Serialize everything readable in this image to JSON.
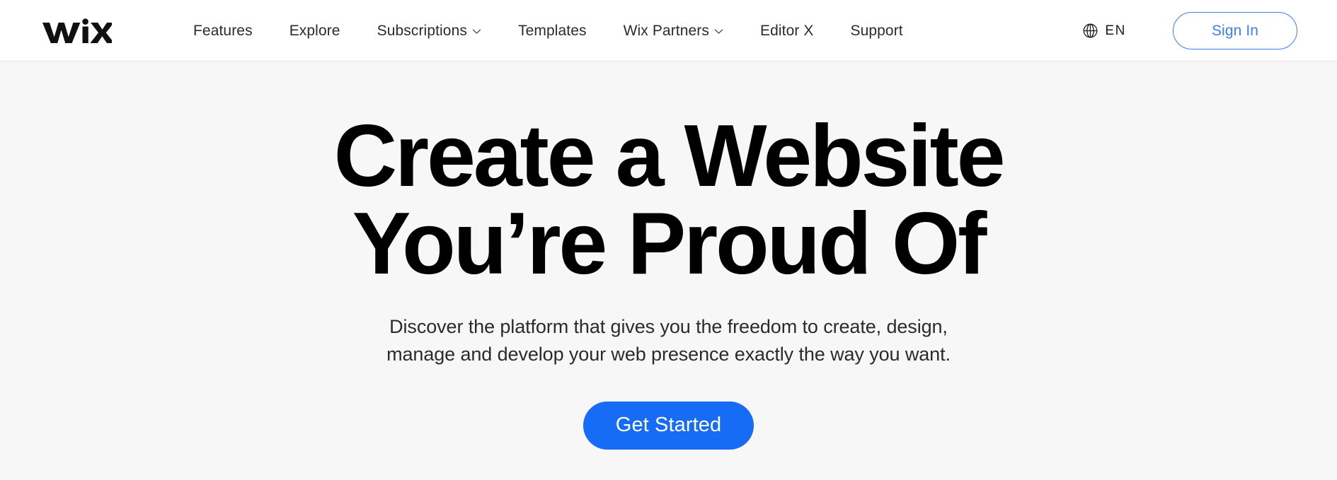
{
  "colors": {
    "accent_blue": "#166cf5",
    "link_blue": "#3d7cf5",
    "nav_background": "#ffffff",
    "hero_background": "#f7f7f7",
    "text_dark": "#2b2b2b",
    "heading_black": "#000000",
    "nav_border": "#e8e8e8"
  },
  "navbar": {
    "logo": {
      "name": "wix-logo",
      "text": "WiX"
    },
    "links": [
      {
        "label": "Features",
        "has_dropdown": false,
        "icon": null
      },
      {
        "label": "Explore",
        "has_dropdown": false,
        "icon": null
      },
      {
        "label": "Subscriptions",
        "has_dropdown": true,
        "icon": "chevron-down-icon"
      },
      {
        "label": "Templates",
        "has_dropdown": false,
        "icon": null
      },
      {
        "label": "Wix Partners",
        "has_dropdown": true,
        "icon": "chevron-down-icon"
      },
      {
        "label": "Editor X",
        "has_dropdown": false,
        "icon": null
      },
      {
        "label": "Support",
        "has_dropdown": false,
        "icon": null
      }
    ],
    "language_selector": {
      "icon": "globe-icon",
      "label": "EN"
    },
    "sign_in": {
      "label": "Sign In"
    }
  },
  "hero": {
    "title_line_1": "Create a Website",
    "title_line_2": "You’re Proud Of",
    "subtitle_line_1": "Discover the platform that gives you the freedom to create, design,",
    "subtitle_line_2": "manage and develop your web presence exactly the way you want.",
    "cta_label": "Get Started"
  }
}
